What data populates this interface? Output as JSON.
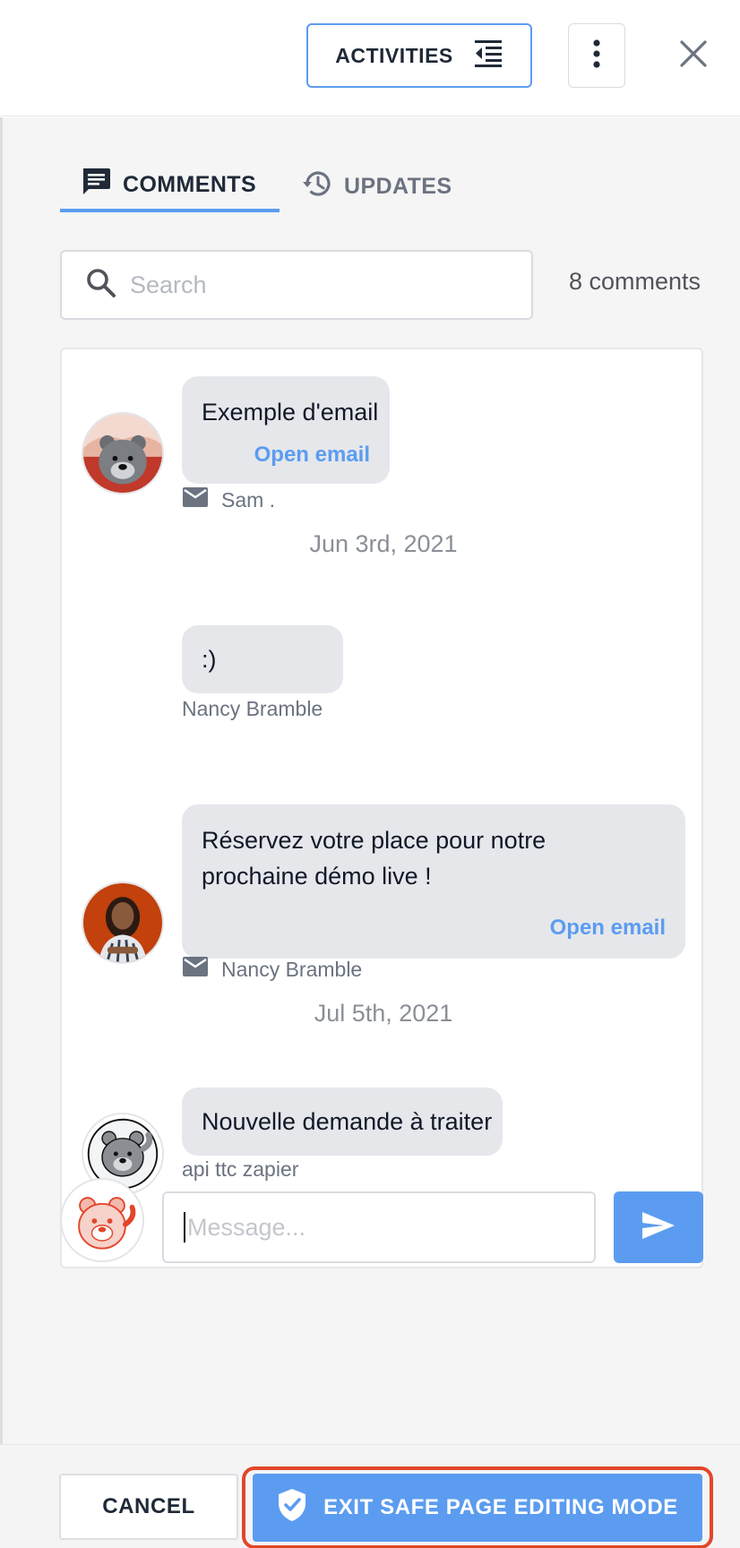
{
  "header": {
    "activities_label": "ACTIVITIES",
    "icons": {
      "activities": "indent-list-icon",
      "more": "more-vertical-icon",
      "close": "close-icon"
    }
  },
  "tabs": [
    {
      "label": "COMMENTS",
      "icon": "comment-icon",
      "active": true
    },
    {
      "label": "UPDATES",
      "icon": "history-icon",
      "active": false
    }
  ],
  "search": {
    "placeholder": "Search",
    "value": ""
  },
  "comment_count": "8 comments",
  "feed": [
    {
      "type": "message",
      "text": "Exemple d'email",
      "action": "Open email",
      "author": "Sam .",
      "via_email": true,
      "avatar": "bear-avatar-photo"
    },
    {
      "type": "date",
      "text": "Jun 3rd, 2021"
    },
    {
      "type": "message",
      "text": ":)",
      "author": "Nancy Bramble",
      "via_email": false
    },
    {
      "type": "message",
      "text_lines": [
        "Réservez votre place pour notre",
        "prochaine démo live !"
      ],
      "action": "Open email",
      "author": "Nancy Bramble",
      "via_email": true,
      "avatar": "woman-avatar-photo"
    },
    {
      "type": "date",
      "text": "Jul 5th, 2021"
    },
    {
      "type": "message",
      "text": "Nouvelle demande à traiter",
      "author": "api ttc zapier",
      "via_email": false,
      "avatar": "bear-avatar-gray"
    }
  ],
  "composer": {
    "placeholder": "Message...",
    "value": "",
    "send_icon": "send-icon",
    "avatar": "bear-avatar-red"
  },
  "footer": {
    "cancel_label": "CANCEL",
    "exit_label": "EXIT SAFE PAGE EDITING MODE",
    "exit_icon": "shield-check-icon"
  },
  "colors": {
    "accent": "#5b9cf0",
    "highlight": "#e2462a",
    "bubble": "#e5e7eb"
  }
}
